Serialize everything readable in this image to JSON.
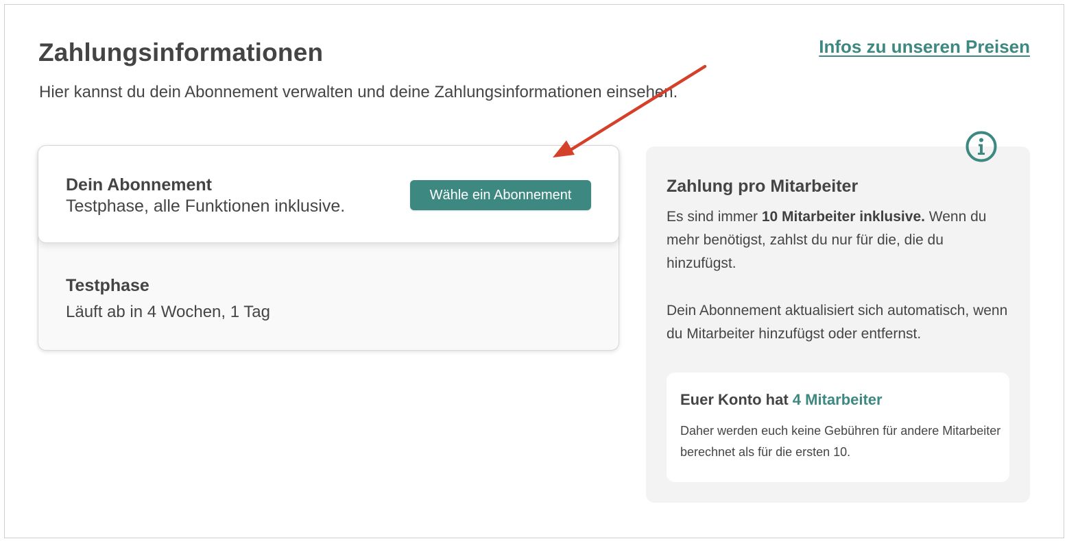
{
  "header": {
    "title": "Zahlungsinformationen",
    "subtitle": "Hier kannst du dein Abonnement verwalten und deine Zahlungsinformationen einsehen.",
    "prices_link": "Infos zu unseren Preisen"
  },
  "subscription": {
    "heading": "Dein Abonnement",
    "description": "Testphase, alle Funktionen inklusive.",
    "choose_button": "Wähle ein Abonnement",
    "trial_heading": "Testphase",
    "trial_expiry": "Läuft ab in 4 Wochen, 1 Tag"
  },
  "info_panel": {
    "icon": "info-icon",
    "heading": "Zahlung pro Mitarbeiter",
    "text1_prefix": "Es sind immer ",
    "text1_bold": "10 Mitarbeiter inklusive.",
    "text1_suffix": " Wenn du mehr benötigst, zahlst du nur für die, die du hinzufügst.",
    "text2": "Dein Abonnement aktualisiert sich automatisch, wenn du Mitarbeiter hinzufügst oder entfernst.",
    "account_prefix": "Euer Konto hat ",
    "account_count": "4 Mitarbeiter",
    "account_note": "Daher werden euch keine Gebühren für andere Mitarbeiter berechnet als für die ersten 10."
  },
  "colors": {
    "accent": "#3d8880",
    "text": "#454545",
    "panel_bg": "#f3f3f3",
    "annotation_arrow": "#d4402a"
  }
}
